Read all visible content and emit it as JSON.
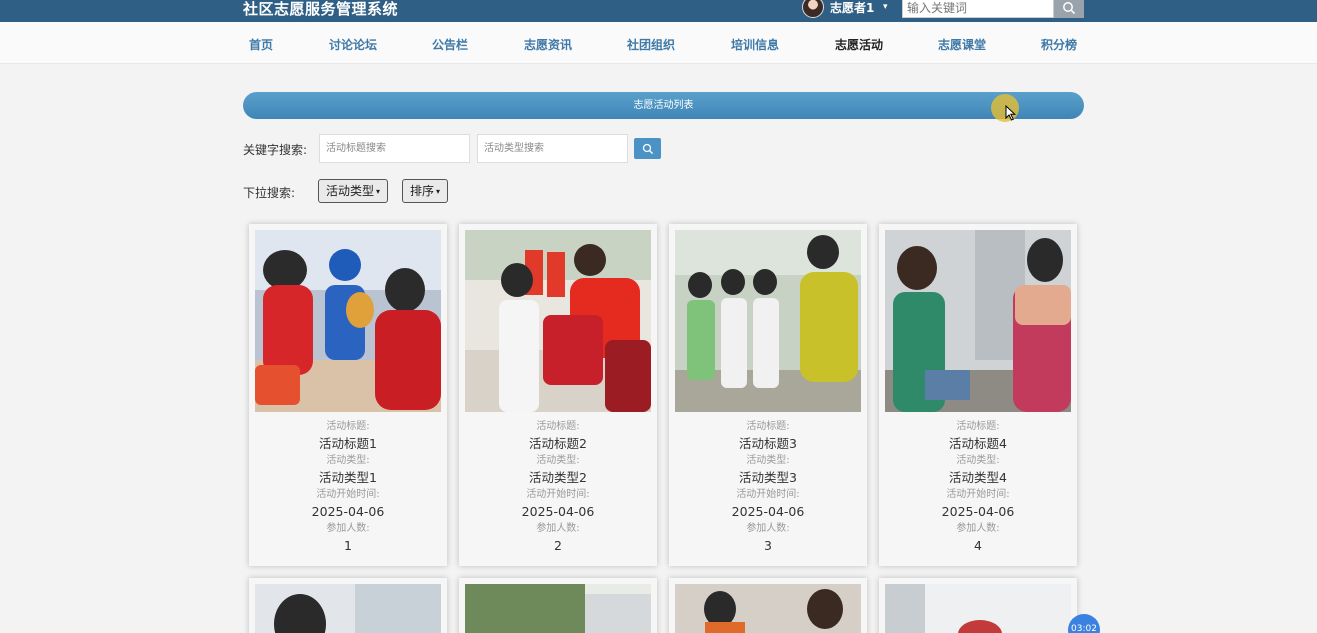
{
  "header": {
    "title": "社区志愿服务管理系统",
    "user_name": "志愿者1",
    "user_caret": "▾",
    "search_placeholder": "输入关键词"
  },
  "nav": {
    "items": [
      {
        "label": "首页"
      },
      {
        "label": "讨论论坛"
      },
      {
        "label": "公告栏"
      },
      {
        "label": "志愿资讯"
      },
      {
        "label": "社团组织"
      },
      {
        "label": "培训信息"
      },
      {
        "label": "志愿活动",
        "active": true
      },
      {
        "label": "志愿课堂"
      },
      {
        "label": "积分榜"
      }
    ]
  },
  "banner": {
    "title": "志愿活动列表"
  },
  "search": {
    "keyword_label": "关键字搜索:",
    "title_placeholder": "活动标题搜索",
    "type_placeholder": "活动类型搜索",
    "dropdown_label": "下拉搜索:",
    "dropdown_type": "活动类型",
    "dropdown_sort": "排序",
    "caret": "▾"
  },
  "cards": [
    {
      "title_label": "活动标题:",
      "title": "活动标题1",
      "type_label": "活动类型:",
      "type": "活动类型1",
      "date_label": "活动开始时间:",
      "date": "2025-04-06",
      "count_label": "参加人数:",
      "count": "1"
    },
    {
      "title_label": "活动标题:",
      "title": "活动标题2",
      "type_label": "活动类型:",
      "type": "活动类型2",
      "date_label": "活动开始时间:",
      "date": "2025-04-06",
      "count_label": "参加人数:",
      "count": "2"
    },
    {
      "title_label": "活动标题:",
      "title": "活动标题3",
      "type_label": "活动类型:",
      "type": "活动类型3",
      "date_label": "活动开始时间:",
      "date": "2025-04-06",
      "count_label": "参加人数:",
      "count": "3"
    },
    {
      "title_label": "活动标题:",
      "title": "活动标题4",
      "type_label": "活动类型:",
      "type": "活动类型4",
      "date_label": "活动开始时间:",
      "date": "2025-04-06",
      "count_label": "参加人数:",
      "count": "4"
    }
  ],
  "timer": "03:02",
  "colors": {
    "topbar": "#2f5f85",
    "nav_link": "#3e79a8",
    "banner": "#4a93c4",
    "accent_button": "#4a93c4"
  }
}
